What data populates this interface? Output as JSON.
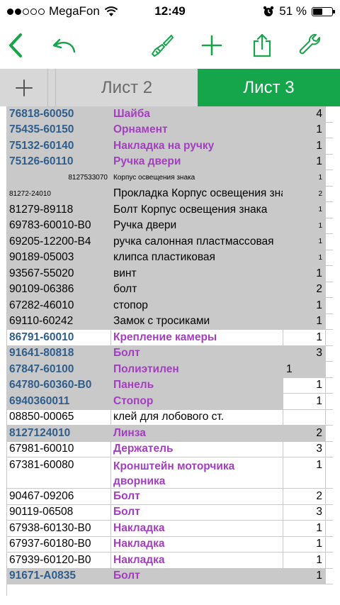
{
  "status_bar": {
    "carrier": "MegaFon",
    "time": "12:49",
    "battery": "51 %",
    "battery_level": 0.51
  },
  "tabs": [
    {
      "label": "Лист 2",
      "active": false
    },
    {
      "label": "Лист 3",
      "active": true
    }
  ],
  "colors": {
    "accent": "#15a54a",
    "code_blue": "#2f5e8c",
    "name_purple": "#a33fbf",
    "highlight": "#c9c9c9"
  },
  "icons": [
    "back-arrow-icon",
    "undo-icon",
    "paintbrush-icon",
    "plus-icon",
    "share-icon",
    "wrench-icon"
  ],
  "rows": [
    {
      "code": "76818-60050",
      "name": "Шайба",
      "qty": "4",
      "style": "hl"
    },
    {
      "code": "75435-60150",
      "name": "Орнамент",
      "qty": "1",
      "style": "hl"
    },
    {
      "code": "75132-60140",
      "name": "Накладка на ручку",
      "qty": "1",
      "style": "hl"
    },
    {
      "code": "75126-60110",
      "name": "Ручка двери",
      "qty": "1",
      "style": "hl"
    },
    {
      "code": "8127533070",
      "name": "Корпус освещения знака",
      "qty": "1",
      "style": "gray-small-right"
    },
    {
      "code": "81272-24010",
      "name": "Прокладка Корпус освещения знака",
      "qty": "2",
      "style": "gray-smallcode"
    },
    {
      "code": "81279-89118",
      "name": "Болт Корпус освещения знака",
      "qty": "1",
      "style": "gray-smallqty"
    },
    {
      "code": "69783-60010-B0",
      "name": "Ручка двери",
      "qty": "1",
      "style": "gray-smallqty"
    },
    {
      "code": "69205-12200-B4",
      "name": "ручка салонная пластмассовая",
      "qty": "1",
      "style": "gray-smallqty"
    },
    {
      "code": "90189-05003",
      "name": "клипса пластиковая",
      "qty": "1",
      "style": "gray-smallqty"
    },
    {
      "code": "93567-55020",
      "name": "винт",
      "qty": "1",
      "style": "gray"
    },
    {
      "code": "90109-06386",
      "name": "болт",
      "qty": "2",
      "style": "gray"
    },
    {
      "code": "67282-46010",
      "name": "стопор",
      "qty": "1",
      "style": "gray"
    },
    {
      "code": "69110-60242",
      "name": "Замок с тросиками",
      "qty": "1",
      "style": "gray"
    },
    {
      "code": "86791-60010",
      "name": "Крепление камеры",
      "qty": "1",
      "style": "white-bold"
    },
    {
      "code": "91641-80818",
      "name": "Болт",
      "qty": "3",
      "style": "hl"
    },
    {
      "code": "67847-60100",
      "name": "Полиэтилен",
      "qty": "1",
      "style": "hl-leftqty"
    },
    {
      "code": "64780-60360-B0",
      "name": "Панель",
      "qty": "1",
      "style": "hl-whiteqty"
    },
    {
      "code": "6940360011",
      "name": "Стопор",
      "qty": "1",
      "style": "hl-whiteqty"
    },
    {
      "code": "08850-00065",
      "name": "клей для лобового ст.",
      "qty": "",
      "style": "white"
    },
    {
      "code": "8127124010",
      "name": "Линза",
      "qty": "2",
      "style": "hl"
    },
    {
      "code": "67981-60010",
      "name": "Держатель",
      "qty": "3",
      "style": "white-purple"
    },
    {
      "code": "67381-60080",
      "name": "Кронштейн моторчика дворника",
      "qty": "1",
      "style": "white-purple-tall"
    },
    {
      "code": "90467-09206",
      "name": "Болт",
      "qty": "2",
      "style": "white-purple"
    },
    {
      "code": "90119-06508",
      "name": "Болт",
      "qty": "3",
      "style": "white-purple"
    },
    {
      "code": "67938-60130-B0",
      "name": "Накладка",
      "qty": "1",
      "style": "white-purple"
    },
    {
      "code": "67937-60180-B0",
      "name": "Накладка",
      "qty": "1",
      "style": "white-purple"
    },
    {
      "code": "67939-60120-B0",
      "name": "Накладка",
      "qty": "1",
      "style": "white-purple"
    },
    {
      "code": "91671-A0835",
      "name": "Болт",
      "qty": "1",
      "style": "hl"
    }
  ]
}
